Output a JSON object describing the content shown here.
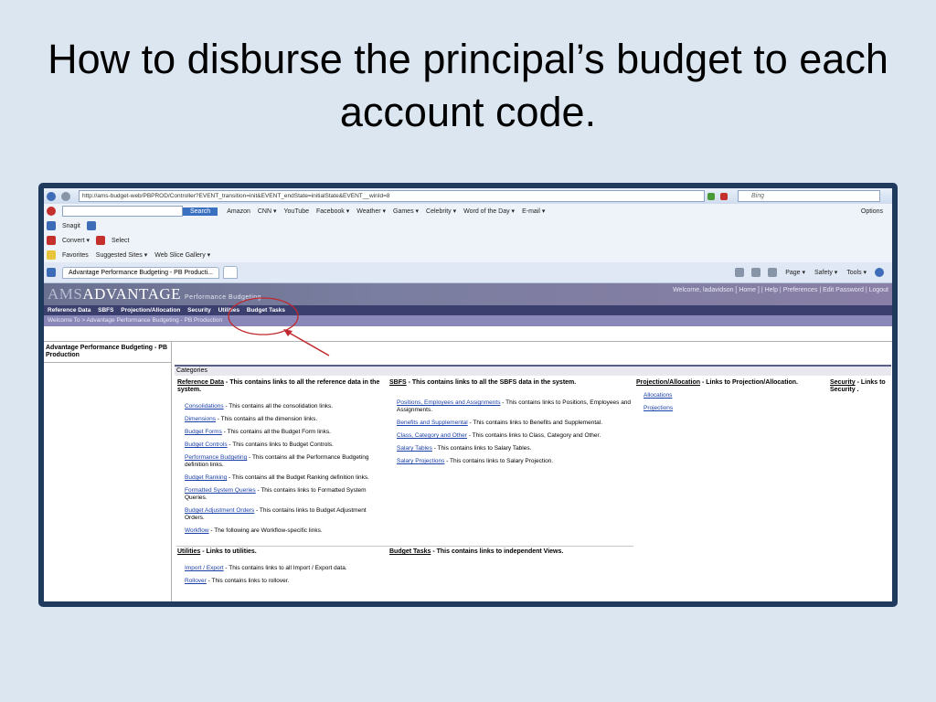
{
  "slide": {
    "title": "How to disburse the principal’s budget to each account code."
  },
  "browser": {
    "url": "http://ams-budget-web/PBPROD/Controller?EVENT_transition=init&EVENT_endState=initialState&EVENT__winId=8",
    "search_placeholder": "Bing",
    "search_button": "Search",
    "links_toolbar": [
      "Amazon",
      "CNN ▾",
      "YouTube",
      "Facebook ▾",
      "Weather ▾",
      "Games ▾",
      "Celebrity ▾",
      "Word of the Day ▾",
      "E-mail ▾"
    ],
    "options_label": "Options",
    "snagit_label": "Snagit",
    "convert_label": "Convert ▾",
    "select_label": "Select",
    "favorites_label": "Favorites",
    "suggested_sites": "Suggested Sites ▾",
    "web_slice_gallery": "Web Slice Gallery ▾",
    "tab_title": "Advantage Performance Budgeting - PB Producti...",
    "cmd_bar": [
      "Page ▾",
      "Safety ▾",
      "Tools ▾"
    ]
  },
  "app": {
    "logo_ams": "AMS",
    "logo_advantage": "ADVANTAGE",
    "logo_sub": "Performance Budgeting",
    "header_links": "Welcome, ladavidson  [ Home  ]  |  Help  |  Preferences  |  Edit Password  |  Logout",
    "menu": [
      "Reference Data",
      "SBFS",
      "Projection/Allocation",
      "Security",
      "Utilities",
      "Budget Tasks"
    ],
    "breadcrumb": "Welcome To  >  Advantage Performance Budgeting - PB Production",
    "sidebar_title": "Advantage Performance Budgeting - PB Production",
    "categories_label": "Categories",
    "reference": {
      "title": "Reference Data",
      "desc": " - This contains links to all the reference data in the system.",
      "items": [
        {
          "link": "Consolidations",
          "text": " - This contains all the consolidation links."
        },
        {
          "link": "Dimensions",
          "text": " - This contains all the dimension links."
        },
        {
          "link": "Budget Forms",
          "text": " - This contains all the Budget Form links."
        },
        {
          "link": "Budget Controls",
          "text": " - This contains links to Budget Controls."
        },
        {
          "link": "Performance Budgeting",
          "text": " - This contains all the Performance Budgeting definition links."
        },
        {
          "link": "Budget Ranking",
          "text": " - This contains all the Budget Ranking definition links."
        },
        {
          "link": "Formatted System Queries",
          "text": " - This contains links to Formatted System Queries."
        },
        {
          "link": "Budget Adjustment Orders",
          "text": " - This contains links to Budget Adjustment Orders."
        },
        {
          "link": "Workflow",
          "text": " - The following are Workflow-specific links."
        }
      ]
    },
    "sbfs": {
      "title": "SBFS",
      "desc": " - This contains links to all the SBFS data in the system.",
      "items": [
        {
          "link": "Positions, Employees and Assignments",
          "text": " - This contains links to Positions, Employees and Assignments."
        },
        {
          "link": "Benefits and Supplemental",
          "text": " - This contains links to Benefits and Supplemental."
        },
        {
          "link": "Class, Category and Other",
          "text": " - This contains links to Class, Category and Other."
        },
        {
          "link": "Salary Tables",
          "text": " - This contains links to Salary Tables."
        },
        {
          "link": "Salary Projections",
          "text": " - This contains links to Salary Projection."
        }
      ]
    },
    "projection": {
      "title": "Projection/Allocation",
      "desc": " - Links to Projection/Allocation.",
      "items": [
        {
          "link": "Allocations"
        },
        {
          "link": "Projections"
        }
      ]
    },
    "security": {
      "title": "Security",
      "desc": " - Links to Security ."
    },
    "utilities": {
      "title": "Utilities",
      "desc": " - Links to utilities.",
      "items": [
        {
          "link": "Import / Export",
          "text": " - This contains links to all Import / Export data."
        },
        {
          "link": "Rollover",
          "text": " - This contains links to rollover."
        }
      ]
    },
    "budget_tasks": {
      "title": "Budget Tasks",
      "desc": " - This contains links to independent Views."
    }
  },
  "colors": {
    "slide_bg": "#dce6f1",
    "frame": "#1f3a5c",
    "menubar": "#3a3f6e",
    "annotation": "#c0282d"
  }
}
